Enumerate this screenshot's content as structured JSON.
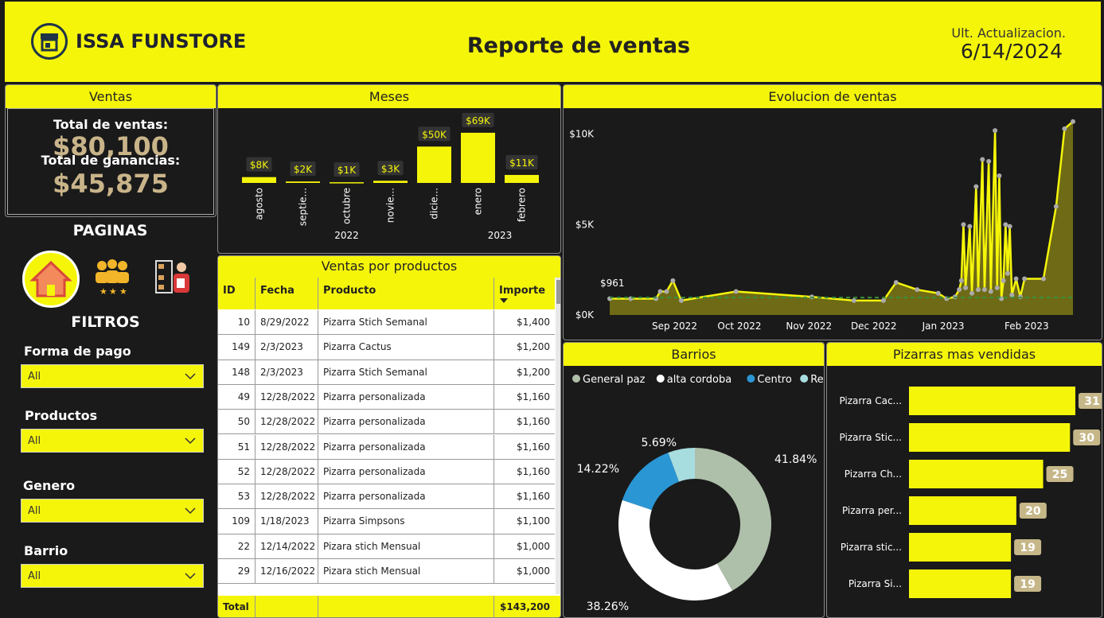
{
  "header": {
    "brand": "ISSA FUNSTORE",
    "title": "Reporte de ventas",
    "update_label": "Ult. Actualizacion.",
    "update_date": "6/14/2024",
    "accent": "#f5f50a"
  },
  "ventas": {
    "title": "Ventas",
    "total_label": "Total de ventas:",
    "total_value": "$80,100",
    "profit_label": "Total de ganancias:",
    "profit_value": "$45,875"
  },
  "nav": {
    "title": "PAGINAS",
    "icons": [
      "home-icon",
      "team-rating-icon",
      "warehouse-worker-icon"
    ]
  },
  "filters": {
    "title": "FILTROS",
    "items": [
      {
        "label": "Forma de pago",
        "value": "All"
      },
      {
        "label": "Productos",
        "value": "All"
      },
      {
        "label": "Genero",
        "value": "All"
      },
      {
        "label": "Barrio",
        "value": "All"
      }
    ]
  },
  "meses": {
    "title": "Meses"
  },
  "tabla": {
    "title": "Ventas por productos",
    "columns": [
      "ID",
      "Fecha",
      "Producto",
      "Importe"
    ],
    "rows": [
      [
        "10",
        "8/29/2022",
        "Pizarra Stich Semanal",
        "$1,400"
      ],
      [
        "149",
        "2/3/2023",
        "Pizarra Cactus",
        "$1,200"
      ],
      [
        "148",
        "2/3/2023",
        "Pizarra Stich Semanal",
        "$1,200"
      ],
      [
        "49",
        "12/28/2022",
        "Pizarra personalizada",
        "$1,160"
      ],
      [
        "50",
        "12/28/2022",
        "Pizarra personalizada",
        "$1,160"
      ],
      [
        "51",
        "12/28/2022",
        "Pizarra personalizada",
        "$1,160"
      ],
      [
        "52",
        "12/28/2022",
        "Pizarra personalizada",
        "$1,160"
      ],
      [
        "53",
        "12/28/2022",
        "Pizarra personalizada",
        "$1,160"
      ],
      [
        "109",
        "1/18/2023",
        "Pizarra Simpsons",
        "$1,100"
      ],
      [
        "22",
        "12/14/2022",
        "Pizara stich Mensual",
        "$1,000"
      ],
      [
        "29",
        "12/16/2022",
        "Pizara stich Mensual",
        "$1,000"
      ]
    ],
    "total_label": "Total",
    "total_value": "$143,200"
  },
  "evol": {
    "title": "Evolucion de ventas"
  },
  "barrios": {
    "title": "Barrios"
  },
  "pizarras": {
    "title": "Pizarras mas vendidas"
  },
  "chart_data": [
    {
      "type": "bar",
      "id": "meses",
      "categories": [
        "agosto",
        "septie...",
        "octubre",
        "novie...",
        "dicie...",
        "enero",
        "febrero"
      ],
      "values": [
        8000,
        2000,
        1000,
        3000,
        50000,
        69000,
        11000
      ],
      "labels": [
        "$8K",
        "$2K",
        "$1K",
        "$3K",
        "$50K",
        "$69K",
        "$11K"
      ],
      "year_groups": [
        {
          "label": "2022",
          "span": [
            0,
            4
          ]
        },
        {
          "label": "2023",
          "span": [
            5,
            6
          ]
        }
      ],
      "color": "#f5f50a"
    },
    {
      "type": "area",
      "id": "evolucion",
      "x_ticks": [
        "Sep 2022",
        "Oct 2022",
        "Nov 2022",
        "Dec 2022",
        "Jan 2023",
        "Feb 2023"
      ],
      "y_ticks": [
        "$0K",
        "$5K",
        "$10K"
      ],
      "ylim": [
        0,
        11000
      ],
      "reference_label": "$961",
      "reference_value": 961,
      "points": [
        [
          0,
          900
        ],
        [
          0.05,
          900
        ],
        [
          0.11,
          900
        ],
        [
          0.12,
          1300
        ],
        [
          0.135,
          1300
        ],
        [
          0.15,
          1900
        ],
        [
          0.17,
          800
        ],
        [
          0.3,
          1300
        ],
        [
          0.48,
          1000
        ],
        [
          0.58,
          800
        ],
        [
          0.65,
          800
        ],
        [
          0.68,
          1800
        ],
        [
          0.73,
          1400
        ],
        [
          0.78,
          1200
        ],
        [
          0.8,
          900
        ],
        [
          0.82,
          1000
        ],
        [
          0.83,
          1400
        ],
        [
          0.835,
          1900
        ],
        [
          0.84,
          5000
        ],
        [
          0.845,
          1500
        ],
        [
          0.855,
          4900
        ],
        [
          0.86,
          1200
        ],
        [
          0.87,
          7100
        ],
        [
          0.875,
          1400
        ],
        [
          0.885,
          8600
        ],
        [
          0.89,
          1400
        ],
        [
          0.9,
          8500
        ],
        [
          0.905,
          1300
        ],
        [
          0.915,
          10200
        ],
        [
          0.92,
          1500
        ],
        [
          0.925,
          7700
        ],
        [
          0.93,
          900
        ],
        [
          0.935,
          1900
        ],
        [
          0.94,
          5000
        ],
        [
          0.945,
          2300
        ],
        [
          0.95,
          4900
        ],
        [
          0.955,
          1100
        ],
        [
          0.965,
          2000
        ],
        [
          0.975,
          1000
        ],
        [
          0.985,
          2000
        ],
        [
          1.03,
          2000
        ],
        [
          1.06,
          6000
        ],
        [
          1.08,
          10300
        ],
        [
          1.1,
          10700
        ]
      ]
    },
    {
      "type": "pie",
      "id": "barrios",
      "series": [
        {
          "name": "General paz",
          "value": 41.84,
          "label": "41.84%",
          "color": "#aebfaa"
        },
        {
          "name": "alta cordoba",
          "value": 38.26,
          "label": "38.26%",
          "color": "#ffffff"
        },
        {
          "name": "Centro",
          "value": 14.22,
          "label": "14.22%",
          "color": "#2b96d4"
        },
        {
          "name": "Retiró",
          "value": 5.69,
          "label": "5.69%",
          "color": "#a8dde0"
        }
      ]
    },
    {
      "type": "bar",
      "id": "pizarras",
      "orientation": "horizontal",
      "categories": [
        "Pizarra Cac...",
        "Pizarra Stic...",
        "Pizarra Ch...",
        "Pizarra per...",
        "Pizarra stic...",
        "Pizarra Si..."
      ],
      "values": [
        31,
        30,
        25,
        20,
        19,
        19
      ],
      "color": "#f5f50a"
    }
  ]
}
